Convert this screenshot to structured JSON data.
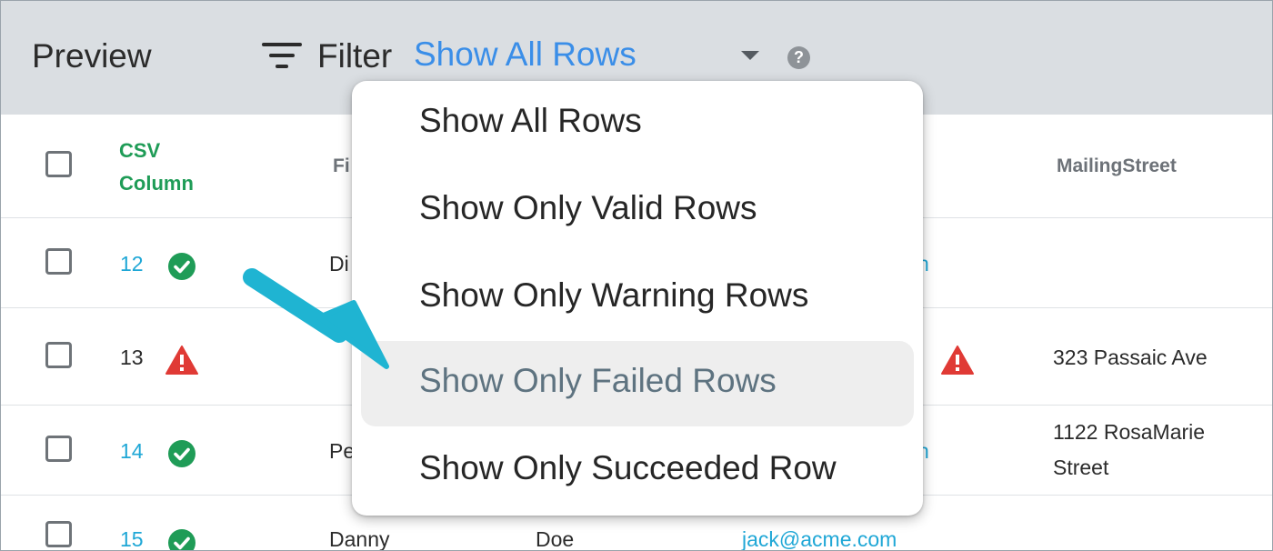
{
  "header": {
    "title": "Preview",
    "filter_label": "Filter",
    "filter_value": "Show All Rows",
    "help_icon": "?"
  },
  "table": {
    "columns": {
      "csv_line1": "CSV",
      "csv_line2": "Column",
      "first_name_partial": "Fi",
      "mailing_street": "MailingStreet"
    },
    "rows": [
      {
        "num": "12",
        "status": "success",
        "first": "Di",
        "email_partial": "n",
        "street": ""
      },
      {
        "num": "13",
        "status": "warning",
        "first": "",
        "email_partial": "",
        "street": "323 Passaic Ave"
      },
      {
        "num": "14",
        "status": "success",
        "first": "Pe",
        "email_partial": "n",
        "street_line1": "1122 RosaMarie",
        "street_line2": "Street"
      },
      {
        "num": "15",
        "status": "success",
        "first": "Danny",
        "last": "Doe",
        "email": "jack@acme.com"
      }
    ]
  },
  "dropdown": {
    "options": [
      {
        "label": "Show All Rows"
      },
      {
        "label": "Show Only Valid Rows"
      },
      {
        "label": "Show Only Warning Rows"
      },
      {
        "label": "Show Only Failed Rows",
        "highlighted": true
      },
      {
        "label": "Show Only Succeeded Row"
      }
    ]
  },
  "colors": {
    "header_bg": "#dadee2",
    "accent_blue": "#3a8ee8",
    "success_green": "#1f9c57",
    "warning_red": "#e03a35",
    "link_blue": "#1fa7d6",
    "arrow_cyan": "#1fb4d2"
  }
}
